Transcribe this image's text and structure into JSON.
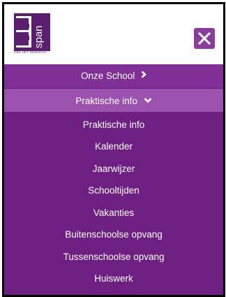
{
  "header": {
    "logo": {
      "letters": "3",
      "wordmark": "span",
      "tagline": "OBS HET DRIESPAN",
      "colors": {
        "primary": "#5b1e6e",
        "accent": "#ffffff"
      }
    },
    "close_icon": "close-icon"
  },
  "colors": {
    "menu_bg": "#6d1f82",
    "top_item_bg": "#7f2f95",
    "active_item_bg": "#9a52ae",
    "close_btn_bg": "#8a3d9f",
    "text": "#ffffff"
  },
  "menu": {
    "items": [
      {
        "label": "Onze School",
        "icon": "chevron-right-icon",
        "expanded": false
      },
      {
        "label": "Praktische info",
        "icon": "chevron-down-icon",
        "expanded": true
      }
    ],
    "submenu": [
      {
        "label": "Praktische info"
      },
      {
        "label": "Kalender"
      },
      {
        "label": "Jaarwijzer"
      },
      {
        "label": "Schooltijden"
      },
      {
        "label": "Vakanties"
      },
      {
        "label": "Buitenschoolse opvang"
      },
      {
        "label": "Tussenschoolse opvang"
      },
      {
        "label": "Huiswerk"
      }
    ]
  }
}
